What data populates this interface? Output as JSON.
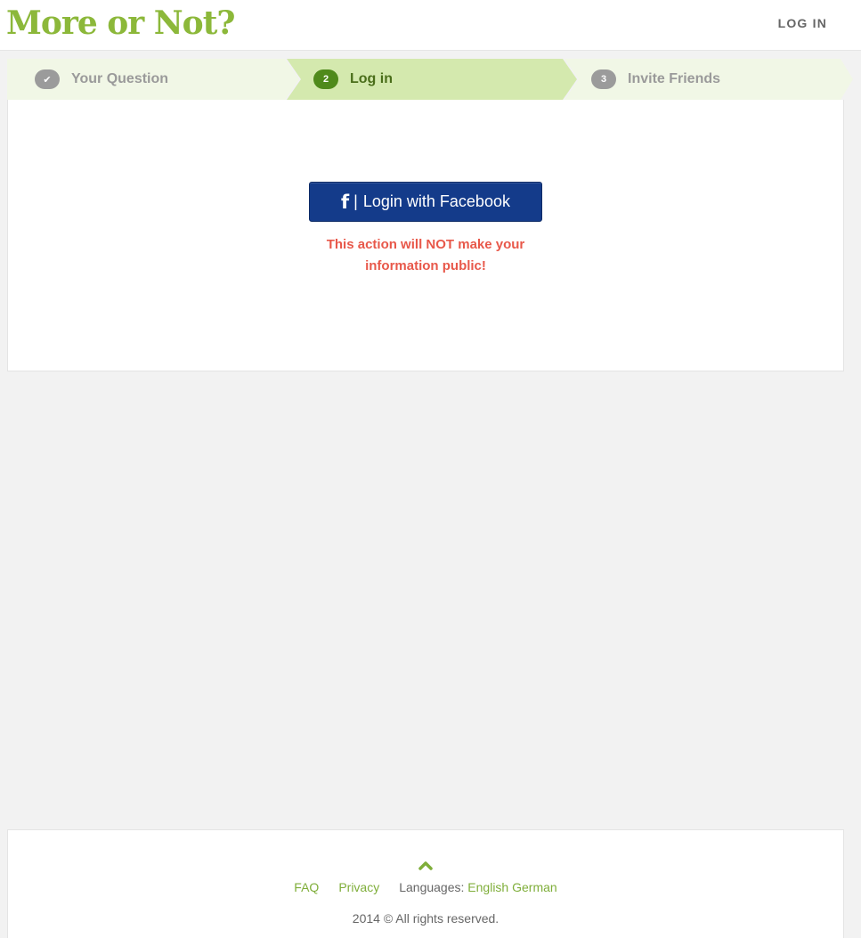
{
  "header": {
    "logo_text": "More or Not?",
    "login_label": "LOG IN"
  },
  "stepper": {
    "steps": [
      {
        "badge": "✔",
        "label": "Your Question",
        "state": "completed"
      },
      {
        "badge": "2",
        "label": "Log in",
        "state": "active"
      },
      {
        "badge": "3",
        "label": "Invite Friends",
        "state": "upcoming"
      }
    ]
  },
  "main": {
    "facebook_icon": "f",
    "facebook_separator": "|",
    "facebook_label": "Login with Facebook",
    "notice_line1": "This action will NOT make your",
    "notice_line2": "information public!"
  },
  "footer": {
    "faq": "FAQ",
    "privacy": "Privacy",
    "languages_label": "Languages:",
    "language_english": "English",
    "language_german": "German",
    "copyright": "2014 © All rights reserved."
  },
  "colors": {
    "brand_green": "#8cb83a",
    "facebook_blue": "#143b8a",
    "notice_red": "#e8584a",
    "step_active_bg": "#d4e9ae",
    "step_inactive_bg": "#f1f7e6"
  },
  "icons": {
    "scroll_top": "chevron-up-icon",
    "facebook": "facebook-icon",
    "completed": "checkmark-icon"
  }
}
